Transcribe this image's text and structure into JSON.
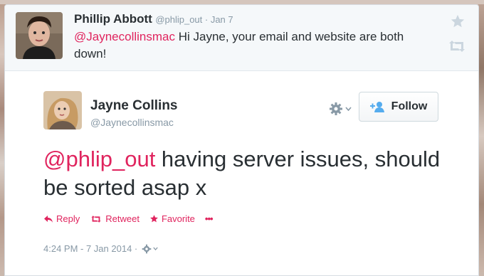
{
  "reply": {
    "name": "Phillip Abbott",
    "meta": "@phlip_out · Jan 7",
    "mention": "@Jaynecollinsmac",
    "text": " Hi Jayne, your email and website are both down!"
  },
  "tweet": {
    "name": "Jayne Collins",
    "handle": "@Jaynecollinsmac",
    "follow_label": "Follow",
    "mention": "@phlip_out",
    "text": " having server issues, should be sorted asap x",
    "actions": {
      "reply": "Reply",
      "retweet": "Retweet",
      "favorite": "Favorite",
      "more": "•••"
    },
    "timestamp": "4:24 PM - 7 Jan 2014 ·"
  },
  "icons": {
    "star": "star-icon",
    "retweet": "retweet-icon",
    "gear": "gear-icon",
    "add_user": "add-user-icon",
    "reply": "reply-icon"
  },
  "colors": {
    "accent": "#e0245e",
    "follow_blue": "#55acee",
    "muted": "#8899a6",
    "text": "#292f33"
  }
}
